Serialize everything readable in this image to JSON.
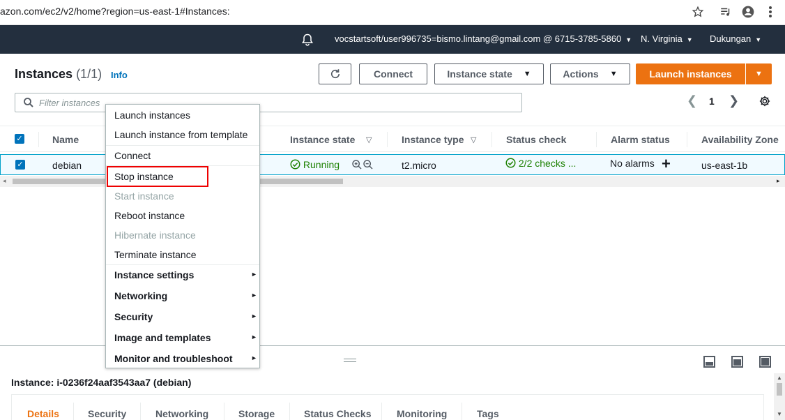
{
  "browser": {
    "url": "azon.com/ec2/v2/home?region=us-east-1#Instances:",
    "icons": [
      "star-icon",
      "playlist-icon",
      "profile-icon",
      "kebab-menu-icon"
    ]
  },
  "topnav": {
    "account": "vocstartsoft/user996735=bismo.lintang@gmail.com @ 6715-3785-5860",
    "region": "N. Virginia",
    "support": "Dukungan"
  },
  "header": {
    "title": "Instances",
    "count": "(1/1)",
    "info": "Info",
    "connect": "Connect",
    "instance_state": "Instance state",
    "actions": "Actions",
    "launch": "Launch instances"
  },
  "filter": {
    "placeholder": "Filter instances"
  },
  "pager": {
    "page": "1"
  },
  "table": {
    "columns": [
      "Name",
      "Instance state",
      "Instance type",
      "Status check",
      "Alarm status",
      "Availability Zone"
    ],
    "row": {
      "name": "debian",
      "state": "Running",
      "type": "t2.micro",
      "status": "2/2 checks ...",
      "alarm": "No alarms",
      "zone": "us-east-1b"
    }
  },
  "menu": {
    "items": [
      {
        "label": "Launch instances",
        "enabled": true
      },
      {
        "label": "Launch instance from template",
        "enabled": true
      },
      {
        "label": "Connect",
        "enabled": true
      },
      {
        "label": "Stop instance",
        "enabled": true
      },
      {
        "label": "Start instance",
        "enabled": false
      },
      {
        "label": "Reboot instance",
        "enabled": true
      },
      {
        "label": "Hibernate instance",
        "enabled": false
      },
      {
        "label": "Terminate instance",
        "enabled": true
      },
      {
        "label": "Instance settings",
        "enabled": true
      },
      {
        "label": "Networking",
        "enabled": true
      },
      {
        "label": "Security",
        "enabled": true
      },
      {
        "label": "Image and templates",
        "enabled": true
      },
      {
        "label": "Monitor and troubleshoot",
        "enabled": true
      }
    ]
  },
  "details": {
    "title": "Instance: i-0236f24aaf3543aa7 (debian)",
    "tabs": [
      "Details",
      "Security",
      "Networking",
      "Storage",
      "Status Checks",
      "Monitoring",
      "Tags"
    ]
  },
  "colors": {
    "nav_bg": "#232f3e",
    "primary": "#ec7211",
    "link": "#0073bb",
    "success": "#1d8102",
    "highlight_border": "#ee0000"
  }
}
